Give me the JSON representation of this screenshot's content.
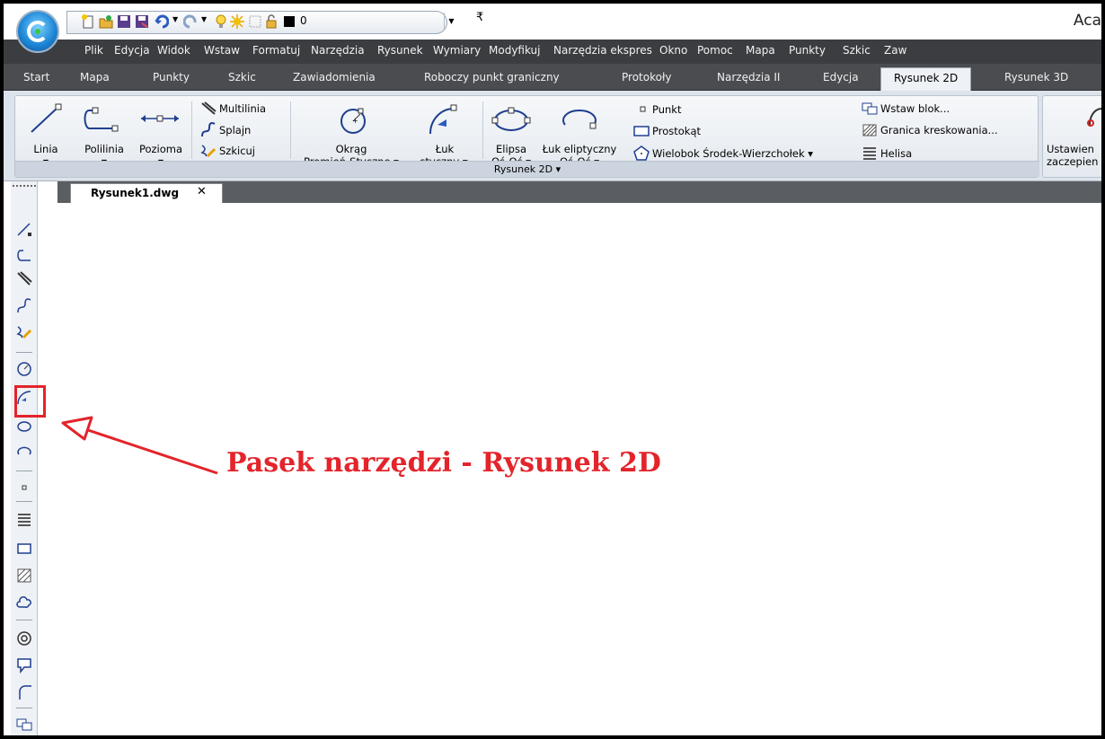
{
  "app": {
    "title_partial": "Aca"
  },
  "quick_access": {
    "layer_value": "0",
    "more_symbol": "₹"
  },
  "menu": [
    "Plik",
    "Edycja",
    "Widok",
    "Wstaw",
    "Formatuj",
    "Narzędzia",
    "Rysunek",
    "Wymiary",
    "Modyfikuj",
    "Narzędzia ekspres",
    "Okno",
    "Pomoc",
    "Mapa",
    "Punkty",
    "Szkic",
    "Zaw"
  ],
  "tabs": [
    "Start",
    "Mapa",
    "Punkty",
    "Szkic",
    "Zawiadomienia",
    "Roboczy punkt graniczny",
    "Protokoły",
    "Narzędzia II",
    "Edycja",
    "Rysunek 2D",
    "Rysunek 3D"
  ],
  "active_tab": "Rysunek 2D",
  "ribbon": {
    "panel_title": "Rysunek 2D ▾",
    "linia": "Linia",
    "polilinia": "Polilinia",
    "pozioma": "Pozioma",
    "multilinia": "Multilinia",
    "splajn": "Splajn",
    "szkicuj": "Szkicuj",
    "okrag_1": "Okrąg",
    "okrag_2": "Promień-Styczne ▾",
    "luk_1": "Łuk",
    "luk_2": "styczny ▾",
    "elipsa_1": "Elipsa",
    "elipsa_2": "Oś-Oś ▾",
    "luk_elip_1": "Łuk eliptyczny",
    "luk_elip_2": "Oś-Oś ▾",
    "punkt": "Punkt",
    "prostokat": "Prostokąt",
    "wielobok": "Wielobok Środek-Wierzchołek ▾",
    "wstaw_blok": "Wstaw blok...",
    "granica": "Granica kreskowania...",
    "helisa": "Helisa",
    "ustawienia_1": "Ustawien",
    "ustawienia_2": "zaczepien"
  },
  "document": {
    "tab_label": "Rysunek1.dwg",
    "close_symbol": "✕"
  },
  "annotation": {
    "text": "Pasek narzędzi - Rysunek 2D",
    "color": "#e3242b"
  },
  "left_toolbar_icons": [
    "line-icon",
    "polyline-icon",
    "multiline-icon",
    "spline-icon",
    "sketch-icon",
    "circle-icon",
    "arc-tangent-icon",
    "ellipse-icon",
    "elliptical-arc-icon",
    "point-icon",
    "helix-icon",
    "rectangle-icon",
    "hatch-boundary-icon",
    "revision-cloud-icon",
    "donut-icon",
    "insert-block-icon",
    "fillet-icon",
    "insert-block-2-icon"
  ]
}
